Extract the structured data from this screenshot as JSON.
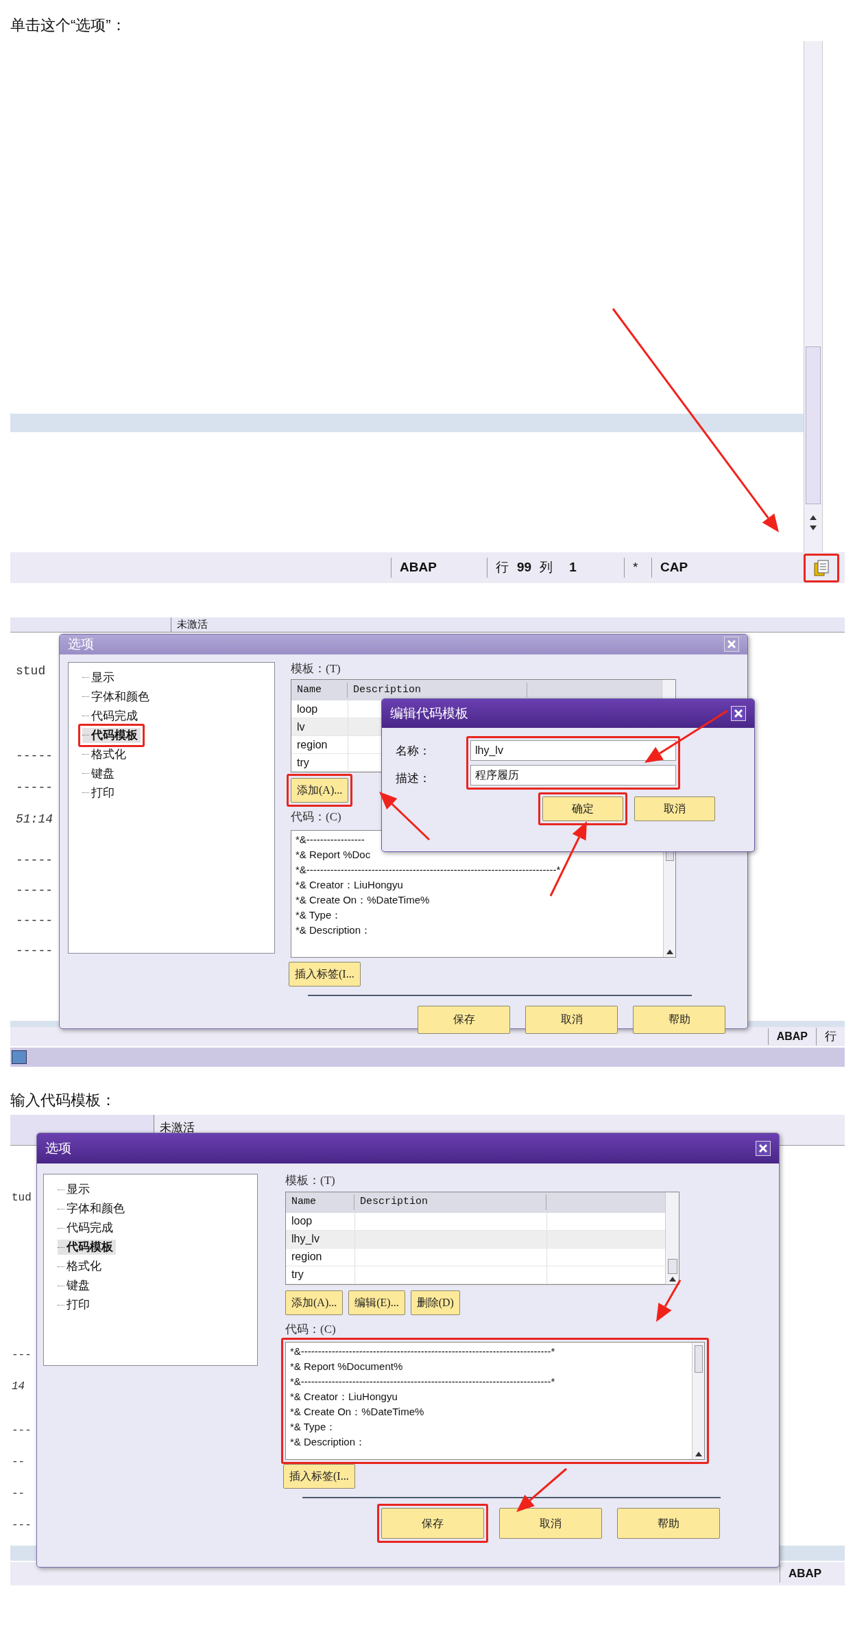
{
  "caption_1": "单击这个“选项”：",
  "screenshot_1": {
    "status_bar": {
      "language": "ABAP",
      "line_label": "行",
      "line": "99",
      "column_label": "列",
      "column": "1",
      "mode": "*",
      "caps": "CAP",
      "options_highlighted": true
    }
  },
  "screenshot_2": {
    "top_bar": {
      "status": "未激活"
    },
    "left_lines": [
      "stud",
      "-----",
      "-----",
      "51:14",
      "-----",
      "-----",
      "-----",
      "-----"
    ],
    "status_bar": {
      "language": "ABAP",
      "line_label": "行"
    },
    "options_dialog": {
      "title": "选项",
      "active": false,
      "tree": [
        {
          "label": "显示",
          "selected": false,
          "highlighted": false
        },
        {
          "label": "字体和颜色",
          "selected": false,
          "highlighted": false
        },
        {
          "label": "代码完成",
          "selected": false,
          "highlighted": false
        },
        {
          "label": "代码模板",
          "selected": true,
          "highlighted": true
        },
        {
          "label": "格式化",
          "selected": false,
          "highlighted": false
        },
        {
          "label": "键盘",
          "selected": false,
          "highlighted": false
        },
        {
          "label": "打印",
          "selected": false,
          "highlighted": false
        }
      ],
      "template_label": "模板：(T)",
      "columns": [
        "Name",
        "Description"
      ],
      "rows": [
        {
          "name": "loop",
          "selected": false
        },
        {
          "name": "lv",
          "selected": true
        },
        {
          "name": "region",
          "selected": false
        },
        {
          "name": "try",
          "selected": false
        }
      ],
      "buttons": [
        {
          "label": "添加(A)...",
          "highlighted": true
        }
      ],
      "code_label": "代码：(C)",
      "code_highlighted": false,
      "code_lines": [
        "*&-----------------",
        "*& Report %Doc",
        "*&-------------------------------------------------------------------------*",
        "*& Creator：LiuHongyu",
        "*& Create On：%DateTime%",
        "*& Type：",
        "*& Description："
      ],
      "insert_button": "插入标签(I...",
      "footer_buttons": [
        {
          "label": "保存",
          "highlighted": false
        },
        {
          "label": "取消",
          "highlighted": false
        },
        {
          "label": "帮助",
          "highlighted": false
        }
      ]
    },
    "edit_dialog": {
      "title": "编辑代码模板",
      "active": true,
      "fields_highlighted": true,
      "fields": [
        {
          "label": "名称：",
          "value": "lhy_lv"
        },
        {
          "label": "描述：",
          "value": "程序履历"
        }
      ],
      "buttons": [
        {
          "label": "确定",
          "highlighted": true
        },
        {
          "label": "取消",
          "highlighted": false
        }
      ]
    }
  },
  "caption_2": "输入代码模板：",
  "screenshot_3": {
    "top_bar": {
      "status": "未激活"
    },
    "left_lines": [
      "tud",
      "---",
      "14",
      "---",
      "--",
      "--",
      "---"
    ],
    "status_bar": {
      "language": "ABAP"
    },
    "options_dialog": {
      "title": "选项",
      "active": true,
      "tree": [
        {
          "label": "显示",
          "selected": false,
          "highlighted": false
        },
        {
          "label": "字体和颜色",
          "selected": false,
          "highlighted": false
        },
        {
          "label": "代码完成",
          "selected": false,
          "highlighted": false
        },
        {
          "label": "代码模板",
          "selected": true,
          "highlighted": false
        },
        {
          "label": "格式化",
          "selected": false,
          "highlighted": false
        },
        {
          "label": "键盘",
          "selected": false,
          "highlighted": false
        },
        {
          "label": "打印",
          "selected": false,
          "highlighted": false
        }
      ],
      "template_label": "模板：(T)",
      "columns": [
        "Name",
        "Description"
      ],
      "rows": [
        {
          "name": "loop",
          "selected": false
        },
        {
          "name": "lhy_lv",
          "selected": true
        },
        {
          "name": "region",
          "selected": false
        },
        {
          "name": "try",
          "selected": false
        }
      ],
      "buttons": [
        {
          "label": "添加(A)...",
          "highlighted": false
        },
        {
          "label": "编辑(E)...",
          "highlighted": false
        },
        {
          "label": "删除(D)",
          "highlighted": false
        }
      ],
      "code_label": "代码：(C)",
      "code_highlighted": true,
      "code_lines": [
        "*&-------------------------------------------------------------------------*",
        "*& Report %Document%",
        "*&-------------------------------------------------------------------------*",
        "*& Creator：LiuHongyu",
        "*& Create On：%DateTime%",
        "*& Type：",
        "*& Description："
      ],
      "insert_button": "插入标签(I...",
      "footer_buttons": [
        {
          "label": "保存",
          "highlighted": true
        },
        {
          "label": "取消",
          "highlighted": false
        },
        {
          "label": "帮助",
          "highlighted": false
        }
      ]
    }
  }
}
